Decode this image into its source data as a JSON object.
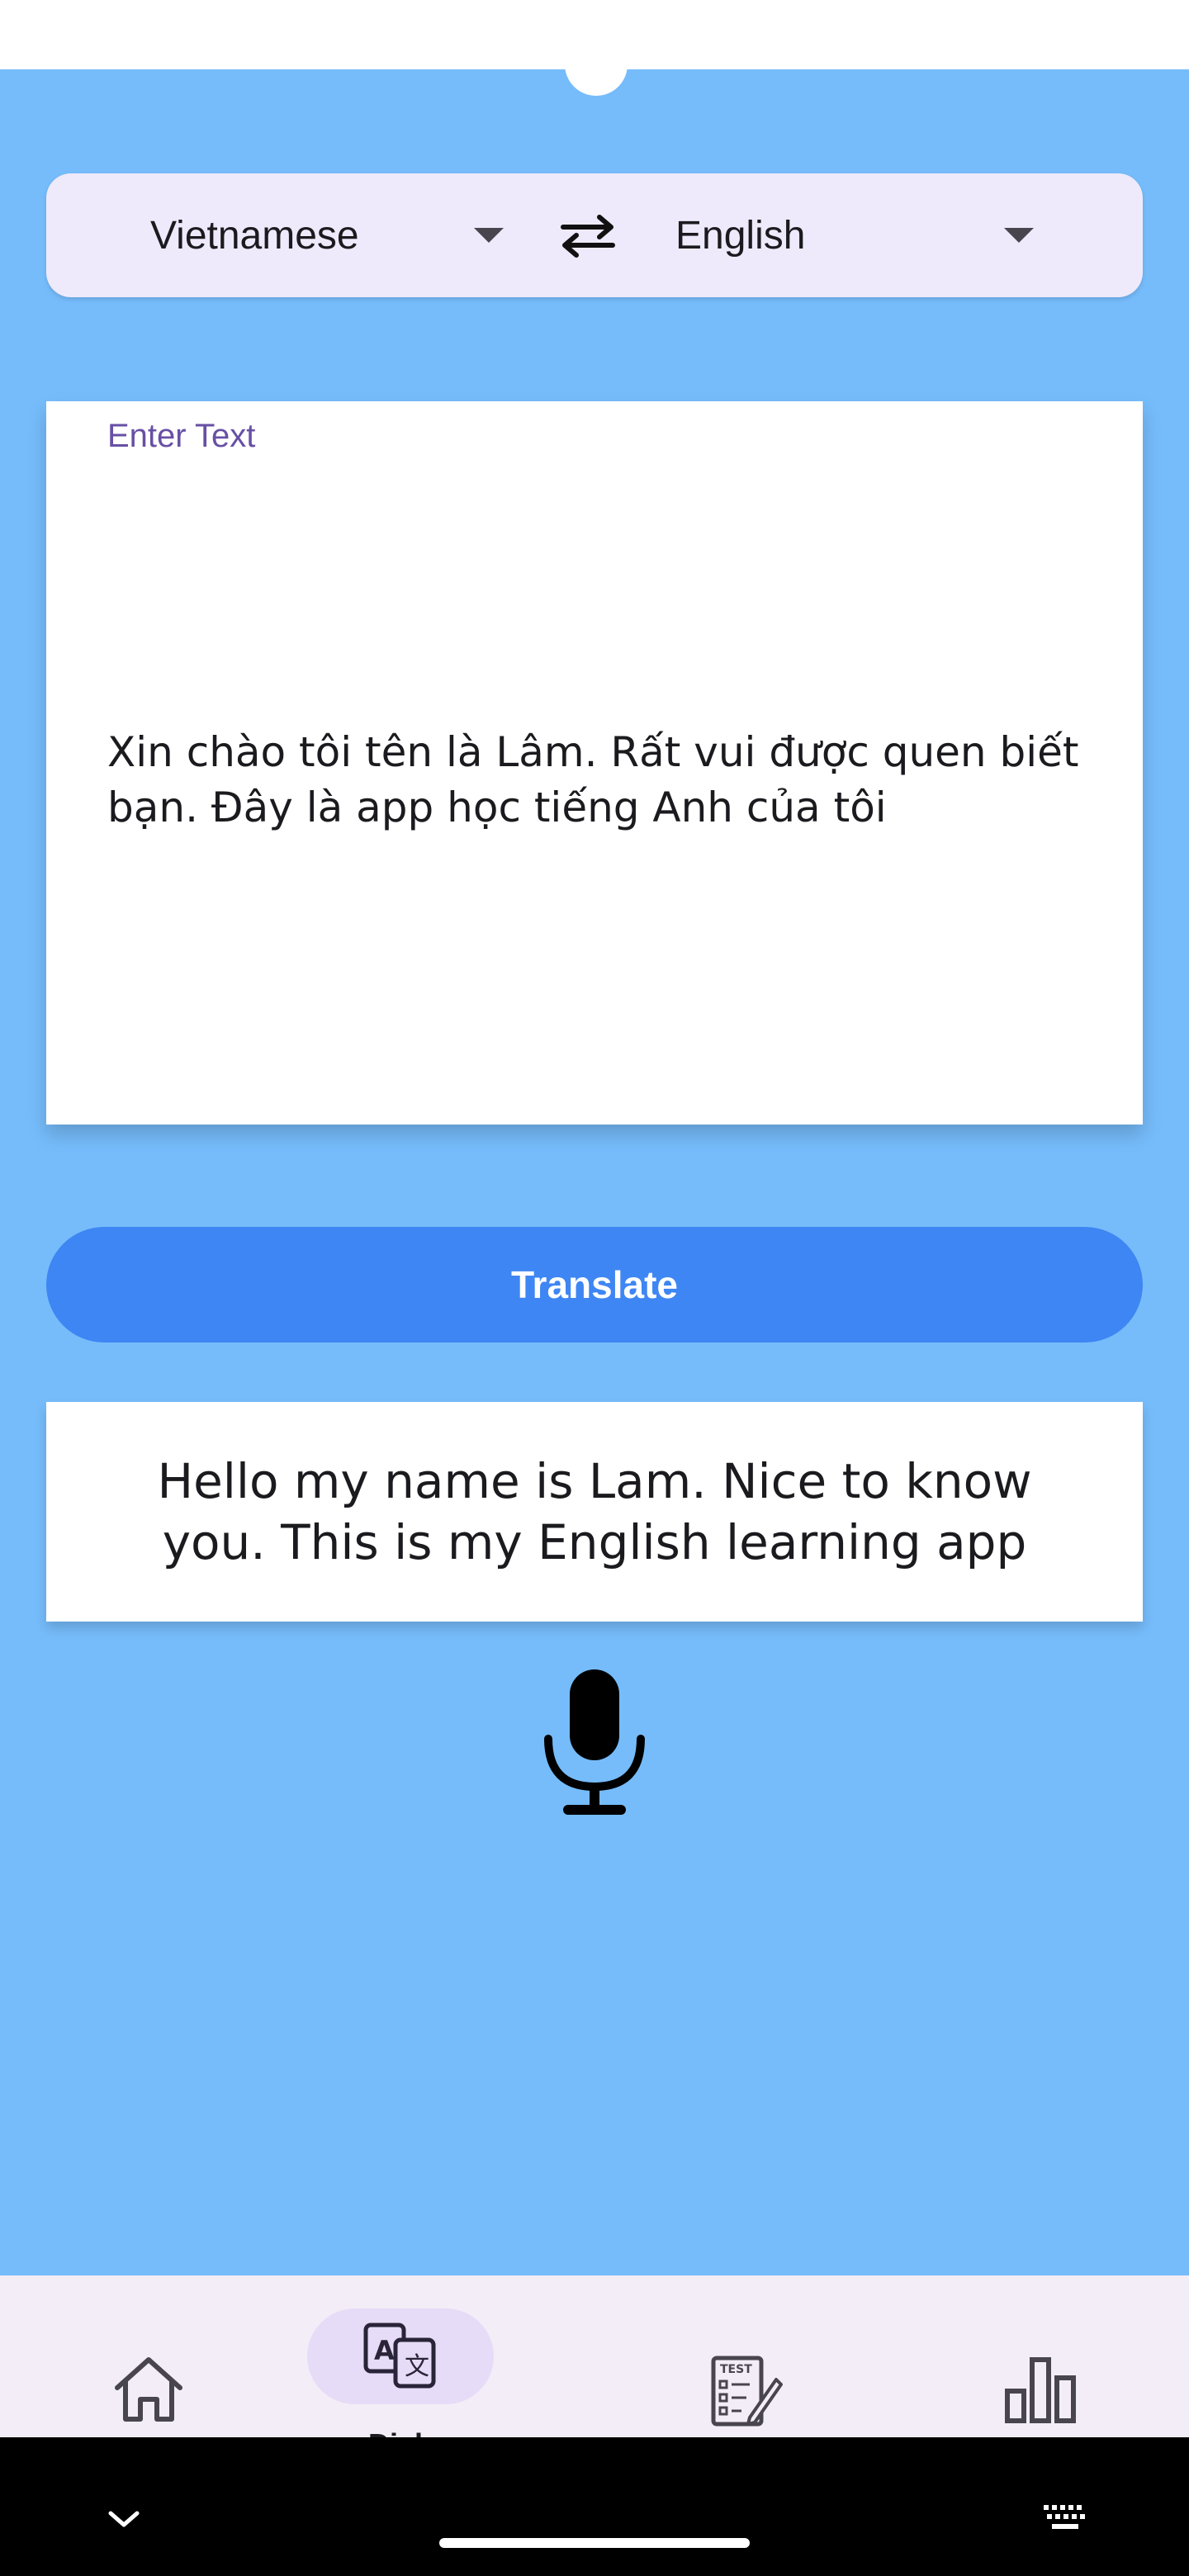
{
  "language_bar": {
    "source_language": "Vietnamese",
    "target_language": "English",
    "swap_icon": "swap-arrows-icon",
    "dropdown_icon": "caret-down-icon"
  },
  "input": {
    "label": "Enter Text",
    "value": "Xin chào tôi tên là Lâm. Rất vui được quen biết bạn. Đây là app học tiếng Anh của tôi"
  },
  "translate_button": {
    "label": "Translate"
  },
  "result": {
    "text": "Hello my name is Lam. Nice to know you. This is my English learning app"
  },
  "mic_icon": "microphone-icon",
  "bottom_nav": {
    "items": [
      {
        "icon": "home-icon",
        "label": ""
      },
      {
        "icon": "translate-icon",
        "label": "Dich",
        "selected": true
      },
      {
        "icon": "test-icon",
        "label": ""
      },
      {
        "icon": "bar-chart-icon",
        "label": ""
      }
    ]
  },
  "system_nav": {
    "back_icon": "chevron-down-icon",
    "keyboard_icon": "keyboard-icon"
  },
  "colors": {
    "background": "#76bcfb",
    "button": "#3e86f3",
    "label_accent": "#6750a4",
    "selector_bg": "#efeafb",
    "nav_bg": "#f3edf7"
  }
}
